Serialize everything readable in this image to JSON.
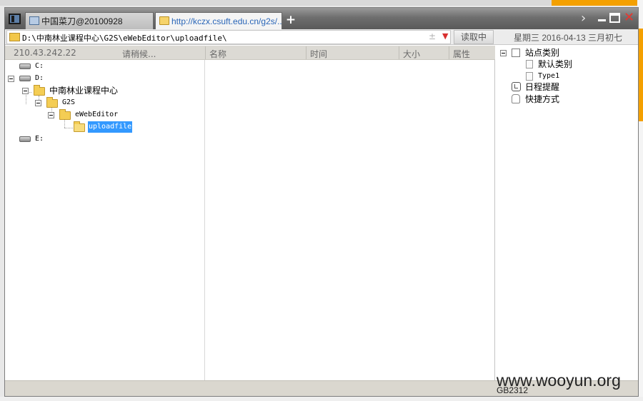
{
  "tabs": [
    {
      "label": "中国菜刀@20100928"
    },
    {
      "label": "http://kczx.csuft.edu.cn/g2s/..."
    }
  ],
  "new_tab_label": "+",
  "window_controls": {
    "chevron": "›",
    "close": "✕"
  },
  "address": {
    "path": "D:\\中南林业课程中心\\G2S\\eWebEditor\\uploadfile\\",
    "plusminus": "±",
    "read_button": "读取中",
    "date": "星期三 2016-04-13 三月初七"
  },
  "columns": {
    "ip": "210.43.242.22",
    "status": "请稍候...",
    "name": "名称",
    "time": "时间",
    "size": "大小",
    "attr": "属性"
  },
  "tree": {
    "c": "C:",
    "d": "D:",
    "d1": "中南林业课程中心",
    "d2": "G2S",
    "d3": "eWebEditor",
    "d4": "uploadfile",
    "e": "E:"
  },
  "right_panel": {
    "root": "站点类别",
    "default": "默认类别",
    "type1": "Type1",
    "schedule": "日程提醒",
    "shortcut": "快捷方式"
  },
  "status": {
    "encoding": "GB2312"
  },
  "watermark": "www.wooyun.org",
  "colors": {
    "selection": "#3399ff",
    "tab_link": "#2a66b8",
    "folder": "#f4cd54",
    "close": "#e8372f"
  },
  "icons": [
    "window-icon",
    "page-icon",
    "folder-icon",
    "drive-icon",
    "clock-icon",
    "hand-icon",
    "close-icon",
    "minimize-icon",
    "maximize-icon"
  ]
}
